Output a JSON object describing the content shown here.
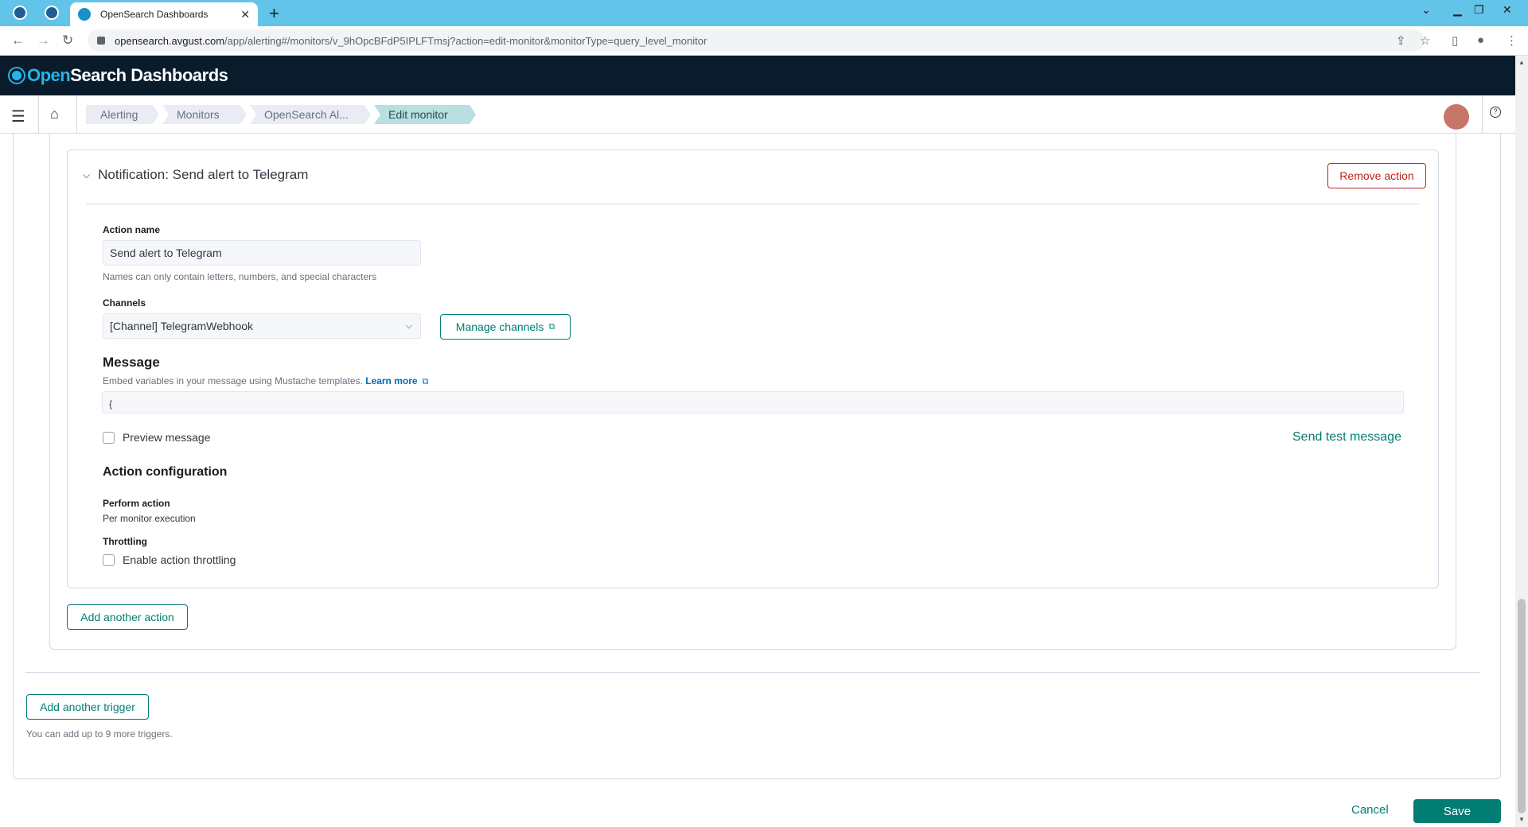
{
  "browser": {
    "tab_title": "OpenSearch Dashboards",
    "url_host": "opensearch.avgust.com",
    "url_path": "/app/alerting#/monitors/v_9hOpcBFdP5IPLFTmsj?action=edit-monitor&monitorType=query_level_monitor"
  },
  "app": {
    "logo_prefix": "Open",
    "logo_suffix": "Search Dashboards"
  },
  "breadcrumbs": [
    "Alerting",
    "Monitors",
    "OpenSearch Al...",
    "Edit monitor"
  ],
  "action": {
    "header": "Notification: Send alert to Telegram",
    "remove_label": "Remove action",
    "name_label": "Action name",
    "name_value": "Send alert to Telegram",
    "name_help": "Names can only contain letters, numbers, and special characters",
    "channels_label": "Channels",
    "channels_value": "[Channel] TelegramWebhook",
    "manage_channels": "Manage channels",
    "message_title": "Message",
    "message_help": "Embed variables in your message using Mustache templates.",
    "learn_more": "Learn more",
    "message_value": "{",
    "preview_label": "Preview message",
    "send_test": "Send test message",
    "config_title": "Action configuration",
    "perform_label": "Perform action",
    "perform_value": "Per monitor execution",
    "throttling_label": "Throttling",
    "throttling_check": "Enable action throttling"
  },
  "add_action": "Add another action",
  "add_trigger": "Add another trigger",
  "trigger_help": "You can add up to 9 more triggers.",
  "footer": {
    "cancel": "Cancel",
    "save": "Save"
  },
  "colors": {
    "primary": "#017d73",
    "danger": "#bd271e",
    "header_bg": "#0a1b2b",
    "chrome_bg": "#62c4e8"
  }
}
